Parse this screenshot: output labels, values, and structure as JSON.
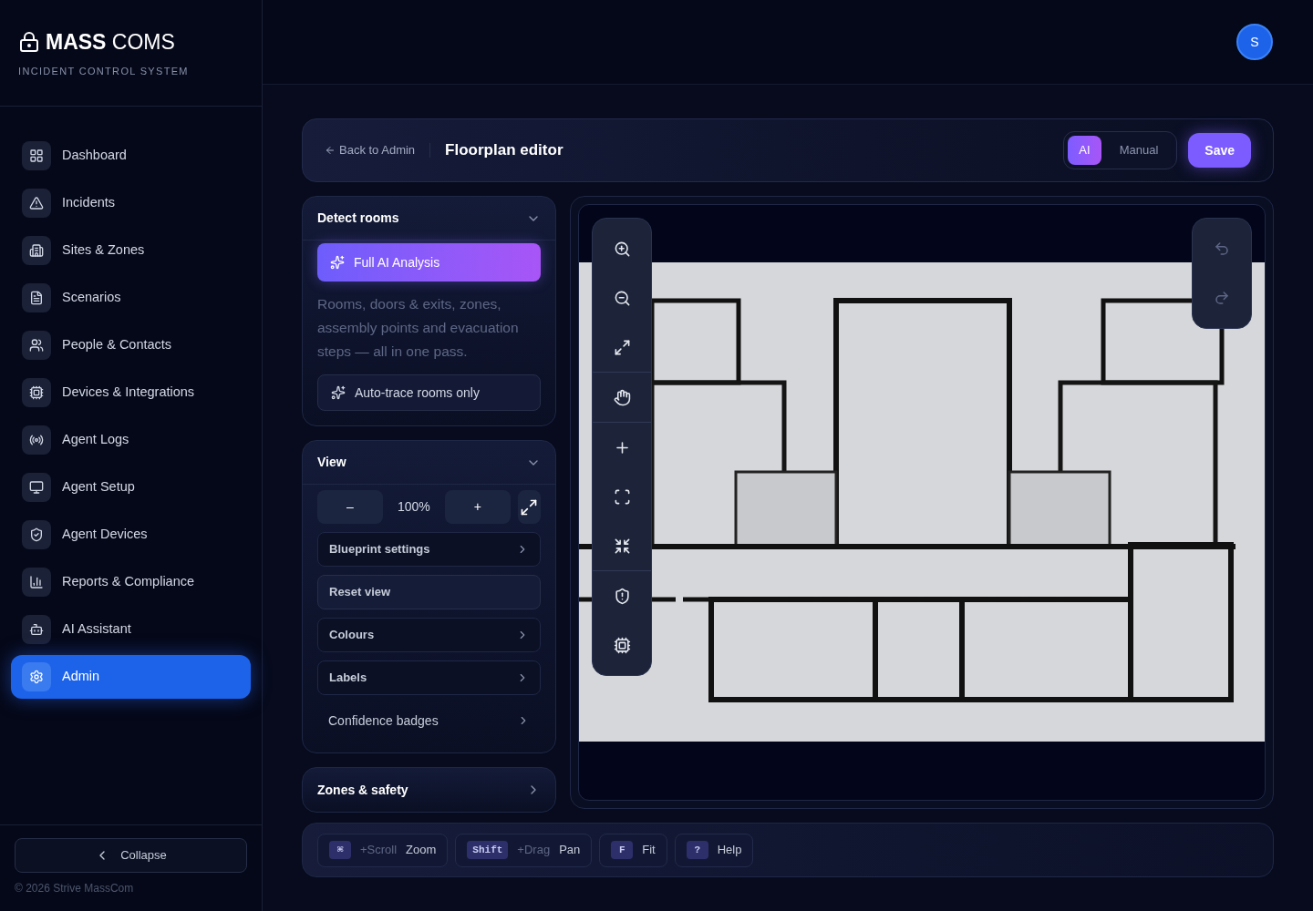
{
  "brand": {
    "name_bold": "MASS",
    "name_light": "COMS",
    "tagline": "INCIDENT CONTROL SYSTEM"
  },
  "sidebar": {
    "items": [
      {
        "label": "Dashboard",
        "selected": false
      },
      {
        "label": "Incidents",
        "selected": false
      },
      {
        "label": "Sites & Zones",
        "selected": false
      },
      {
        "label": "Scenarios",
        "selected": false
      },
      {
        "label": "People & Contacts",
        "selected": false
      },
      {
        "label": "Devices & Integrations",
        "selected": false
      },
      {
        "label": "Agent Logs",
        "selected": false
      },
      {
        "label": "Agent Setup",
        "selected": false
      },
      {
        "label": "Agent Devices",
        "selected": false
      },
      {
        "label": "Reports & Compliance",
        "selected": false
      },
      {
        "label": "AI Assistant",
        "selected": false
      },
      {
        "label": "Admin",
        "selected": true
      }
    ],
    "collapse": "Collapse",
    "copyright": "© 2026 Strive MassCom"
  },
  "user": {
    "initial": "S"
  },
  "editor": {
    "back": "Back to Admin",
    "title": "Floorplan editor",
    "modes": [
      {
        "label": "AI",
        "selected": true
      },
      {
        "label": "Manual",
        "selected": false
      }
    ],
    "save": "Save"
  },
  "detect": {
    "title": "Detect rooms",
    "expanded": true,
    "primary": "Full AI Analysis",
    "description": "Rooms, doors & exits, zones, assembly points and evacuation steps — all in one pass.",
    "secondary": "Auto-trace rooms only"
  },
  "view": {
    "title": "View",
    "expanded": true,
    "zoom_out": "–",
    "zoom": "100%",
    "zoom_in": "+",
    "rows": [
      {
        "label": "Blueprint settings",
        "kind": "submenu"
      },
      {
        "label": "Reset view",
        "kind": "action"
      },
      {
        "label": "Colours",
        "kind": "submenu"
      },
      {
        "label": "Labels",
        "kind": "submenu"
      },
      {
        "label": "Confidence badges",
        "kind": "plain"
      }
    ]
  },
  "zones": {
    "title": "Zones & safety",
    "expanded": false
  },
  "shortcuts": [
    {
      "key": "⌘",
      "modifier": "+Scroll",
      "action": "Zoom"
    },
    {
      "key": "Shift",
      "modifier": "+Drag",
      "action": "Pan"
    },
    {
      "key": "F",
      "action": "Fit"
    },
    {
      "key": "?",
      "action": "Help"
    }
  ]
}
